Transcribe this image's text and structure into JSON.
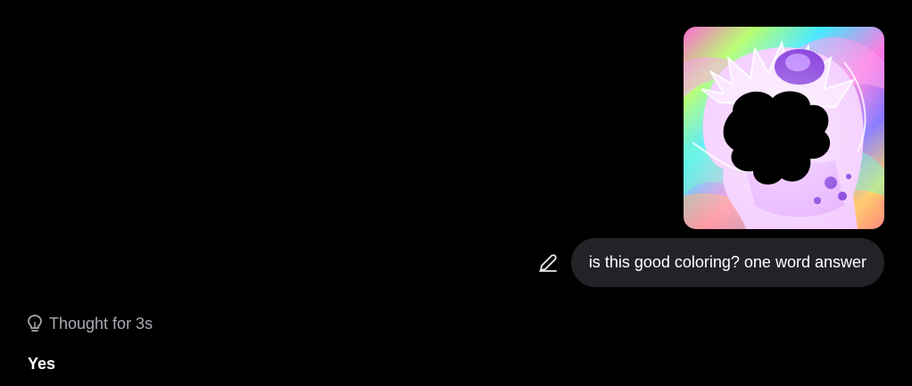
{
  "conversation": {
    "user_message": {
      "attachment": {
        "kind": "image",
        "description_icon": "image-attachment"
      },
      "text": "is this good coloring? one word answer",
      "edit_icon": "pencil-icon"
    },
    "assistant": {
      "thought_label": "Thought for 3s",
      "thought_icon": "lightbulb-icon",
      "answer": "Yes"
    }
  },
  "colors": {
    "background": "#000000",
    "bubble": "#212327",
    "muted_text": "#a8adb3",
    "primary_text": "#ffffff"
  }
}
